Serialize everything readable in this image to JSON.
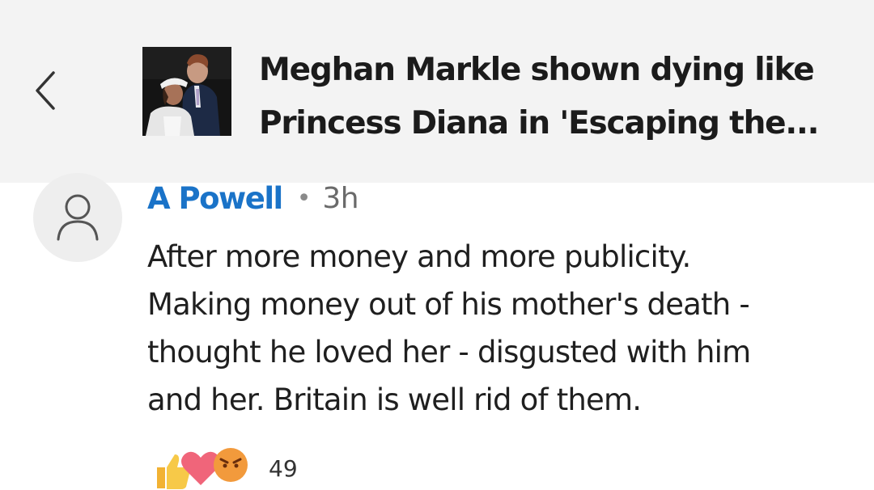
{
  "header": {
    "back_icon": "chevron-left-icon",
    "thumbnail_icon": "article-thumbnail",
    "article_title": "Meghan Markle shown dying like Princess Diana in 'Escaping the..."
  },
  "comment": {
    "avatar_icon": "person-icon",
    "author": "A Powell",
    "separator": "•",
    "time": "3h",
    "text": "After more money and more publicity.\nMaking money out of his mother's death -\nthought he loved her - disgusted with him\nand her.  Britain is well rid of them.",
    "reactions": {
      "icons": [
        "thumbs-up-icon",
        "heart-icon",
        "angry-face-icon"
      ],
      "count": "49"
    }
  },
  "colors": {
    "header_bg": "#f3f3f3",
    "author_link": "#1a73c8",
    "avatar_bg": "#eeeeee",
    "text": "#1f1f1f"
  }
}
